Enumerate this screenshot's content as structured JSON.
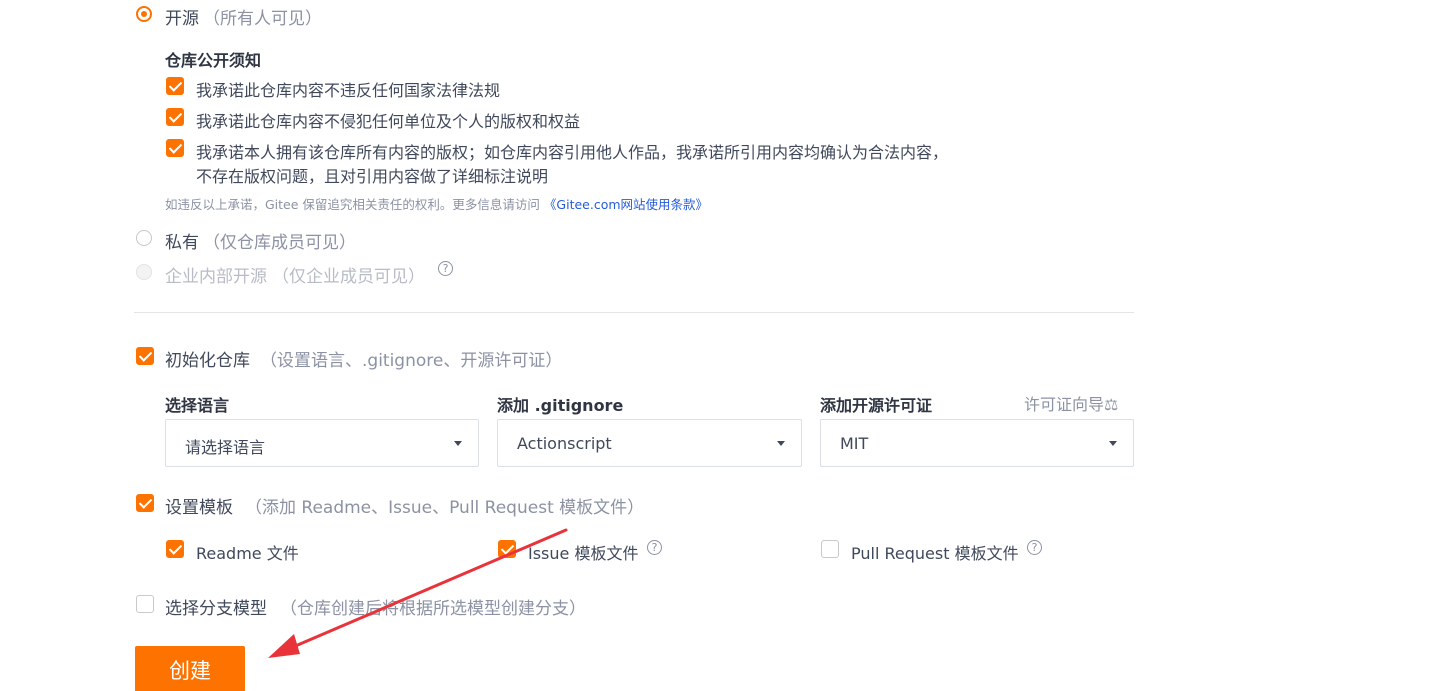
{
  "visibility": {
    "public": {
      "label": "开源",
      "note": "（所有人可见）"
    },
    "public_notice": {
      "title": "仓库公开须知",
      "items": [
        "我承诺此仓库内容不违反任何国家法律法规",
        "我承诺此仓库内容不侵犯任何单位及个人的版权和权益",
        "我承诺本人拥有该仓库所有内容的版权；如仓库内容引用他人作品，我承诺所引用内容均确认为合法内容，",
        "不存在版权问题，且对引用内容做了详细标注说明"
      ],
      "disclaimer": "如违反以上承诺，Gitee 保留追究相关责任的权利。更多信息请访问",
      "terms_link": "《Gitee.com网站使用条款》"
    },
    "private": {
      "label": "私有",
      "note": "（仅仓库成员可见）"
    },
    "enterprise": {
      "label": "企业内部开源",
      "note": "（仅企业成员可见）",
      "help": "?"
    }
  },
  "init_repo": {
    "label": "初始化仓库",
    "note": "（设置语言、.gitignore、开源许可证）",
    "language": {
      "label": "选择语言",
      "value": "请选择语言"
    },
    "gitignore": {
      "label": "添加 .gitignore",
      "value": "Actionscript"
    },
    "license": {
      "label": "添加开源许可证",
      "value": "MIT",
      "wizard": "许可证向导",
      "wizard_icon": "⚖"
    }
  },
  "templates": {
    "label": "设置模板",
    "note": "（添加 Readme、Issue、Pull Request 模板文件）",
    "readme": "Readme 文件",
    "issue": "Issue 模板文件",
    "pull_request": "Pull Request 模板文件",
    "help": "?"
  },
  "branch_model": {
    "label": "选择分支模型",
    "note": "（仓库创建后将根据所选模型创建分支）"
  },
  "create_button": "创建",
  "colors": {
    "accent": "#fe7300",
    "annotation_arrow": "#e8333a"
  }
}
